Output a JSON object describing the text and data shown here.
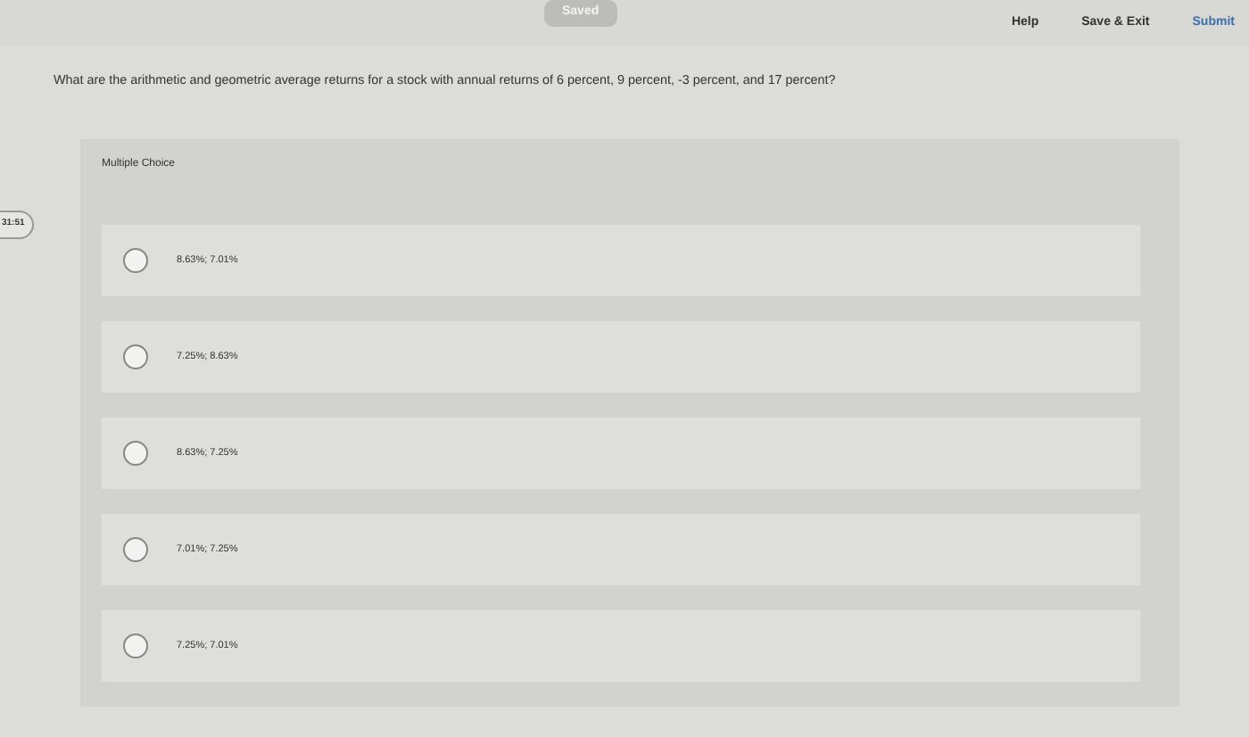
{
  "top_bar": {
    "status": "Saved",
    "links": [
      "Help",
      "Save & Exit",
      "Submit"
    ]
  },
  "timer": "31:51",
  "question": "What are the arithmetic and geometric average returns for a stock with annual returns of 6 percent, 9 percent, -3 percent, and 17 percent?",
  "answer_panel": {
    "heading": "Multiple Choice",
    "options": [
      {
        "label": "8.63%; 7.01%",
        "selected": false
      },
      {
        "label": "7.25%; 8.63%",
        "selected": false
      },
      {
        "label": "8.63%; 7.25%",
        "selected": false
      },
      {
        "label": "7.01%; 7.25%",
        "selected": false
      },
      {
        "label": "7.25%; 7.01%",
        "selected": false
      }
    ]
  }
}
